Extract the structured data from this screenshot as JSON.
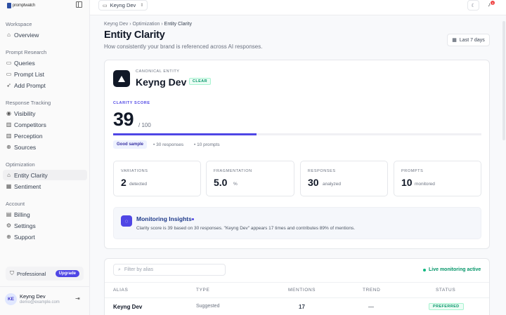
{
  "brand": {
    "name": "promptwatch",
    "accent": "#4f46e5"
  },
  "sidebar": {
    "sections": [
      {
        "label": "Workspace"
      },
      {
        "label": "Prompt Research"
      },
      {
        "label": "Response Tracking"
      },
      {
        "label": "Optimization"
      },
      {
        "label": "Account"
      }
    ],
    "items": [
      {
        "label": "Overview",
        "icon": "home-icon"
      },
      {
        "label": "Queries",
        "icon": "chat-icon"
      },
      {
        "label": "Prompt List",
        "icon": "chat-icon"
      },
      {
        "label": "Add Prompt",
        "icon": "rocket-icon"
      },
      {
        "label": "Visibility",
        "icon": "eye-icon"
      },
      {
        "label": "Competitors",
        "icon": "bar-chart-icon"
      },
      {
        "label": "Perception",
        "icon": "bar-chart-icon"
      },
      {
        "label": "Sources",
        "icon": "globe-icon"
      },
      {
        "label": "Entity Clarity",
        "icon": "home-icon",
        "active": true
      },
      {
        "label": "Sentiment",
        "icon": "chart-icon"
      },
      {
        "label": "Billing",
        "icon": "doc-icon"
      },
      {
        "label": "Settings",
        "icon": "gear-icon"
      },
      {
        "label": "Support",
        "icon": "globe-icon"
      }
    ],
    "plan": {
      "label": "Professional",
      "upgrade_label": "Upgrade"
    },
    "user": {
      "initials": "KE",
      "name": "Keyng Dev",
      "email": "demo@example.com"
    }
  },
  "topbar": {
    "workspace": "Keyng Dev",
    "notification_count": "1"
  },
  "breadcrumb": {
    "items": [
      "Keyng Dev",
      "Optimization",
      "Entity Clarity"
    ],
    "separator": "›"
  },
  "page": {
    "title": "Entity Clarity",
    "subtitle": "How consistently your brand is referenced across AI responses.",
    "date_range": "Last 7 days"
  },
  "entity": {
    "kicker": "CANONICAL ENTITY",
    "name": "Keyng Dev",
    "badge": "CLEAR",
    "score_label": "CLARITY SCORE",
    "score": "39",
    "score_max": "/ 100",
    "score_fraction": 0.39,
    "sample_badge": "Good sample",
    "meta_responses": "• 30 responses",
    "meta_prompts": "• 10 prompts"
  },
  "stats": [
    {
      "label": "VARIATIONS",
      "value": "2",
      "unit": "detected"
    },
    {
      "label": "FRAGMENTATION",
      "value": "5.0",
      "unit": "%"
    },
    {
      "label": "RESPONSES",
      "value": "30",
      "unit": "analyzed"
    },
    {
      "label": "PROMPTS",
      "value": "10",
      "unit": "monitored"
    }
  ],
  "insight": {
    "title": "Monitoring Insights",
    "text": "Clarity score is 39 based on 30 responses. \"Keyng Dev\" appears 17 times and contributes 89% of mentions."
  },
  "aliases": {
    "filter_placeholder": "Filter by alias",
    "live_label": "Live monitoring active",
    "columns": [
      "ALIAS",
      "TYPE",
      "MENTIONS",
      "TREND",
      "STATUS"
    ],
    "rows": [
      {
        "alias": "Keyng Dev",
        "type": "Suggested",
        "mentions": "17",
        "trend": "—",
        "status": "PREFERRED"
      }
    ]
  }
}
